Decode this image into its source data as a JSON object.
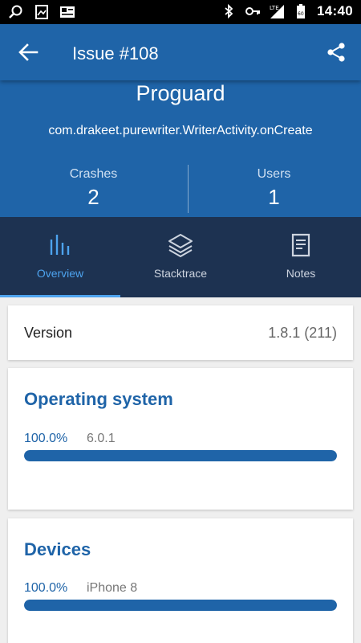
{
  "status_bar": {
    "time": "14:40",
    "left_icons": [
      "search-icon",
      "image-icon",
      "news-icon"
    ],
    "right_icons": [
      "bluetooth-icon",
      "vpn-key-icon",
      "lte-signal-icon",
      "battery-icon"
    ]
  },
  "app_bar": {
    "title": "Issue #108",
    "back_icon": "arrow-back-icon",
    "share_icon": "share-icon"
  },
  "issue": {
    "name": "Proguard",
    "method": "com.drakeet.purewriter.WriterActivity.onCreate",
    "crashes_label": "Crashes",
    "crashes_value": "2",
    "users_label": "Users",
    "users_value": "1"
  },
  "tabs": [
    {
      "label": "Overview",
      "icon": "bar-chart-icon",
      "active": true
    },
    {
      "label": "Stacktrace",
      "icon": "layers-icon",
      "active": false
    },
    {
      "label": "Notes",
      "icon": "note-icon",
      "active": false
    }
  ],
  "version": {
    "label": "Version",
    "value": "1.8.1 (211)"
  },
  "operating_system": {
    "title": "Operating system",
    "percent_text": "100.0%",
    "percent": 100,
    "item": "6.0.1"
  },
  "devices": {
    "title": "Devices",
    "percent_text": "100.0%",
    "percent": 100,
    "item": "iPhone 8"
  },
  "colors": {
    "primary": "#1f64a8",
    "tab_bar": "#1d3251",
    "accent": "#4da3ee"
  }
}
